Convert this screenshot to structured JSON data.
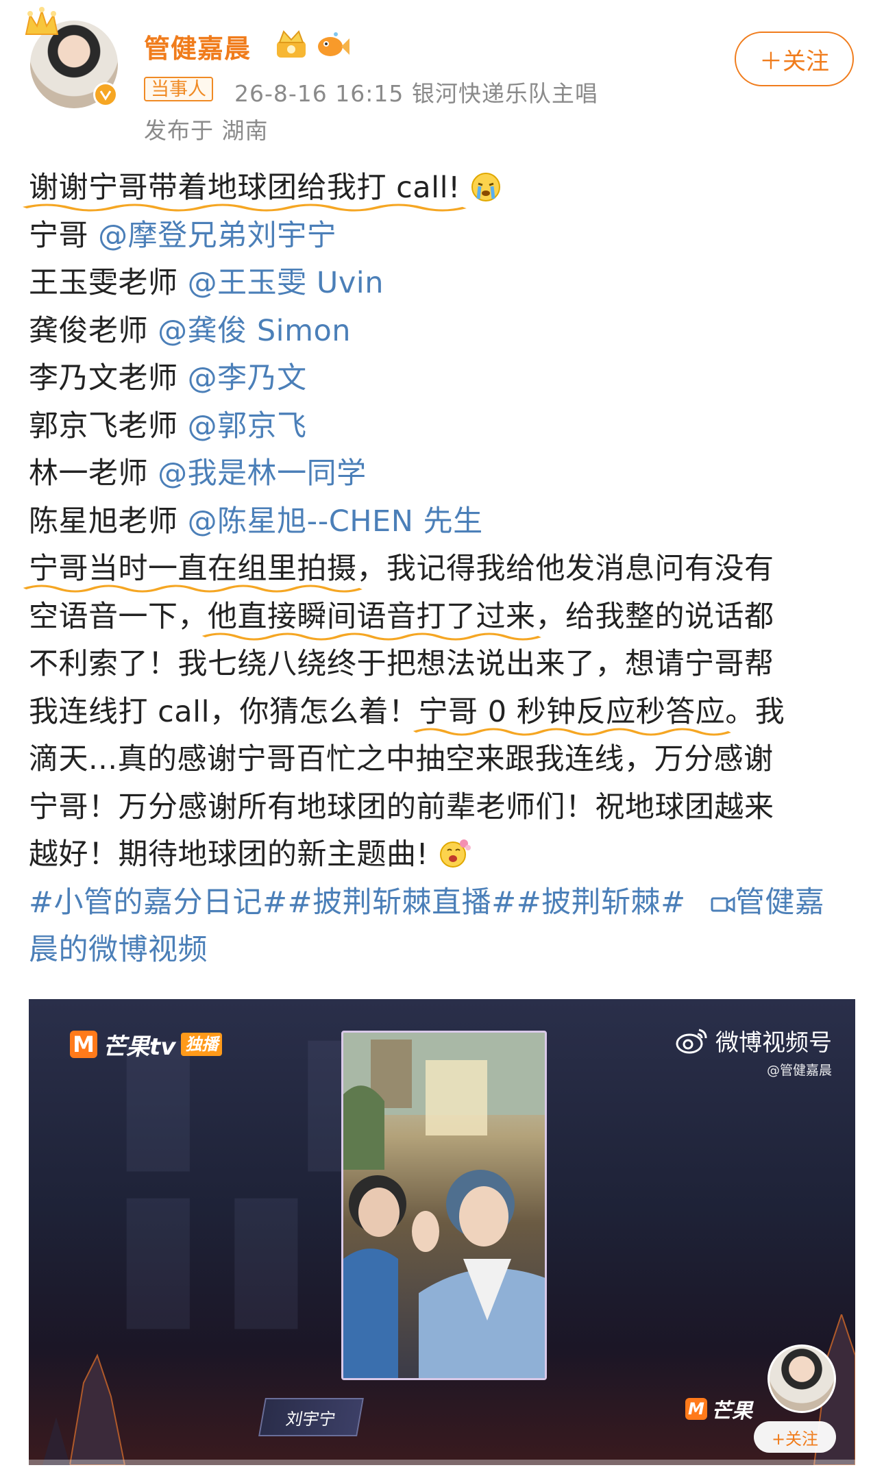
{
  "header": {
    "username": "管健嘉晨",
    "role_tag": "当事人",
    "meta": "26-8-16 16:15  银河快递乐队主唱",
    "location": "发布于 湖南",
    "follow_label": "＋关注"
  },
  "post": {
    "lines": [
      {
        "plain": "",
        "highlight": "谢谢宁哥带着地球团给我打 call!",
        "after": " "
      },
      {
        "plain": "宁哥 ",
        "mention": "@摩登兄弟刘宇宁"
      },
      {
        "plain": "王玉雯老师 ",
        "mention": "@王玉雯 Uvin"
      },
      {
        "plain": "龚俊老师 ",
        "mention": "@龚俊 Simon"
      },
      {
        "plain": "李乃文老师 ",
        "mention": "@李乃文"
      },
      {
        "plain": "郭京飞老师 ",
        "mention": "@郭京飞"
      },
      {
        "plain": "林一老师 ",
        "mention": "@我是林一同学"
      },
      {
        "plain": "陈星旭老师 ",
        "mention": "@陈星旭--CHEN 先生"
      }
    ],
    "para": {
      "l1_hl": "宁哥当时一直在组里拍摄",
      "l1_rest": "，我记得我给他发消息问有没有",
      "l2_pre": "空语音一下，",
      "l2_hl": "他直接瞬间语音打了过来",
      "l2_rest": "，给我整的说话都",
      "l3": "不利索了！我七绕八绕终于把想法说出来了，想请宁哥帮",
      "l4_pre": "我连线打 call，你猜怎么着！",
      "l4_hl": "宁哥 0 秒钟反应秒答应",
      "l4_rest": "。我",
      "l5": "滴天...真的感谢宁哥百忙之中抽空来跟我连线，万分感谢",
      "l6": "宁哥！万分感谢所有地球团的前辈老师们！祝地球团越来",
      "l7": "越好！期待地球团的新主题曲!"
    },
    "topics": "#小管的嘉分日记##披荆斩棘直播##披荆斩棘#",
    "video_link": "管健嘉",
    "video_link_2": "晨的微博视频"
  },
  "video": {
    "platform_logo": "芒果tv",
    "exclusive_badge": "独播",
    "watermark_label": "微博视频号",
    "watermark_handle": "@管健嘉晨",
    "name_plate": "刘宇宁",
    "corner_logo": "芒果",
    "corner_follow": "+关注",
    "progress": 0.0
  },
  "colors": {
    "accent": "#f07c1c",
    "link": "#4b7fb8",
    "highlight_underline": "#f5a623"
  }
}
